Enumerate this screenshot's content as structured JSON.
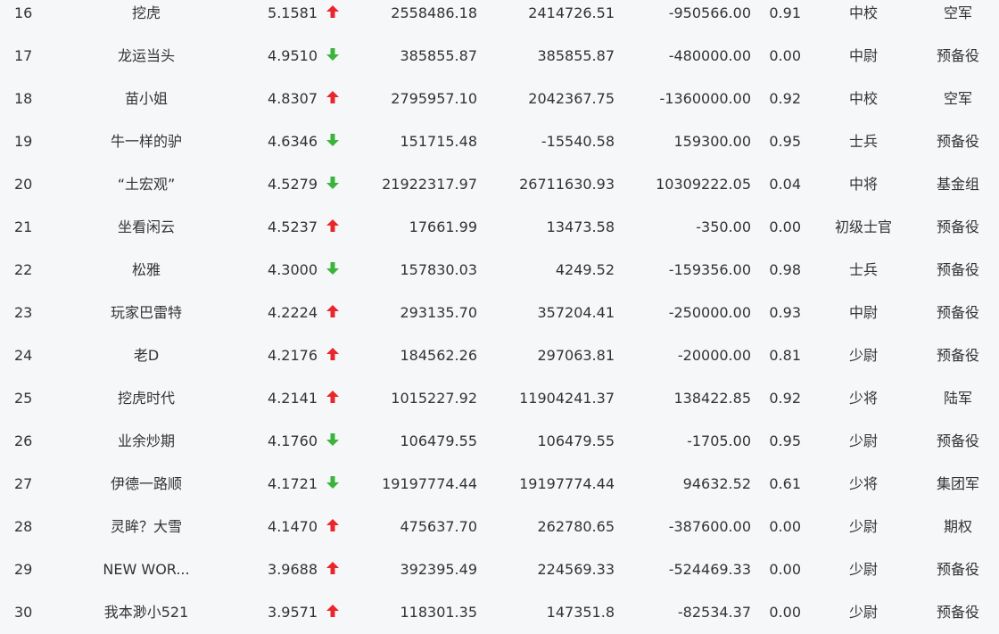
{
  "colors": {
    "background": "#f6f7f9",
    "text": "#333333",
    "up_arrow": "#e8262b",
    "down_arrow": "#3cb43c"
  },
  "rows": [
    {
      "rank": "16",
      "name": "挖虎",
      "score": "5.1581",
      "trend": "up",
      "v1": "2558486.18",
      "v2": "2414726.51",
      "v3": "-950566.00",
      "ratio": "0.91",
      "level": "中校",
      "category": "空军"
    },
    {
      "rank": "17",
      "name": "龙运当头",
      "score": "4.9510",
      "trend": "down",
      "v1": "385855.87",
      "v2": "385855.87",
      "v3": "-480000.00",
      "ratio": "0.00",
      "level": "中尉",
      "category": "预备役"
    },
    {
      "rank": "18",
      "name": "苗小姐",
      "score": "4.8307",
      "trend": "up",
      "v1": "2795957.10",
      "v2": "2042367.75",
      "v3": "-1360000.00",
      "ratio": "0.92",
      "level": "中校",
      "category": "空军"
    },
    {
      "rank": "19",
      "name": "牛一样的驴",
      "score": "4.6346",
      "trend": "down",
      "v1": "151715.48",
      "v2": "-15540.58",
      "v3": "159300.00",
      "ratio": "0.95",
      "level": "士兵",
      "category": "预备役"
    },
    {
      "rank": "20",
      "name": "“土宏观”",
      "score": "4.5279",
      "trend": "down",
      "v1": "21922317.97",
      "v2": "26711630.93",
      "v3": "10309222.05",
      "ratio": "0.04",
      "level": "中将",
      "category": "基金组"
    },
    {
      "rank": "21",
      "name": "坐看闲云",
      "score": "4.5237",
      "trend": "up",
      "v1": "17661.99",
      "v2": "13473.58",
      "v3": "-350.00",
      "ratio": "0.00",
      "level": "初级士官",
      "category": "预备役"
    },
    {
      "rank": "22",
      "name": "松雅",
      "score": "4.3000",
      "trend": "down",
      "v1": "157830.03",
      "v2": "4249.52",
      "v3": "-159356.00",
      "ratio": "0.98",
      "level": "士兵",
      "category": "预备役"
    },
    {
      "rank": "23",
      "name": "玩家巴雷特",
      "score": "4.2224",
      "trend": "up",
      "v1": "293135.70",
      "v2": "357204.41",
      "v3": "-250000.00",
      "ratio": "0.93",
      "level": "中尉",
      "category": "预备役"
    },
    {
      "rank": "24",
      "name": "老D",
      "score": "4.2176",
      "trend": "up",
      "v1": "184562.26",
      "v2": "297063.81",
      "v3": "-20000.00",
      "ratio": "0.81",
      "level": "少尉",
      "category": "预备役"
    },
    {
      "rank": "25",
      "name": "挖虎时代",
      "score": "4.2141",
      "trend": "up",
      "v1": "1015227.92",
      "v2": "11904241.37",
      "v3": "138422.85",
      "ratio": "0.92",
      "level": "少将",
      "category": "陆军"
    },
    {
      "rank": "26",
      "name": "业余炒期",
      "score": "4.1760",
      "trend": "down",
      "v1": "106479.55",
      "v2": "106479.55",
      "v3": "-1705.00",
      "ratio": "0.95",
      "level": "少尉",
      "category": "预备役"
    },
    {
      "rank": "27",
      "name": "伊德一路顺",
      "score": "4.1721",
      "trend": "down",
      "v1": "19197774.44",
      "v2": "19197774.44",
      "v3": "94632.52",
      "ratio": "0.61",
      "level": "少将",
      "category": "集团军"
    },
    {
      "rank": "28",
      "name": "灵眸？大雪",
      "score": "4.1470",
      "trend": "up",
      "v1": "475637.70",
      "v2": "262780.65",
      "v3": "-387600.00",
      "ratio": "0.00",
      "level": "少尉",
      "category": "期权"
    },
    {
      "rank": "29",
      "name": "NEW WOR...",
      "score": "3.9688",
      "trend": "up",
      "v1": "392395.49",
      "v2": "224569.33",
      "v3": "-524469.33",
      "ratio": "0.00",
      "level": "少尉",
      "category": "预备役"
    },
    {
      "rank": "30",
      "name": "我本渺小521",
      "score": "3.9571",
      "trend": "up",
      "v1": "118301.35",
      "v2": "147351.8",
      "v3": "-82534.37",
      "ratio": "0.00",
      "level": "少尉",
      "category": "预备役"
    }
  ]
}
